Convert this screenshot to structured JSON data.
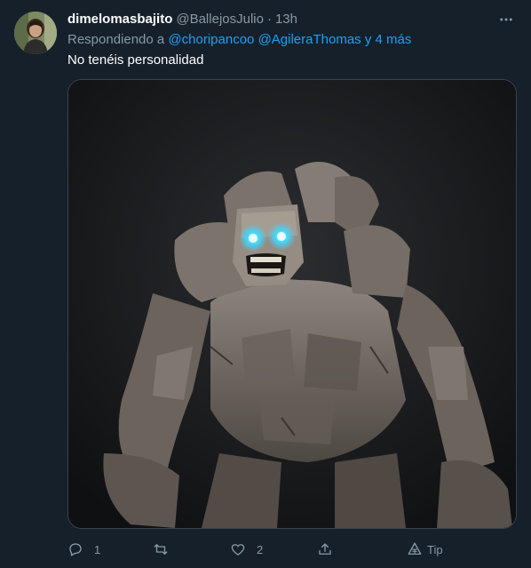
{
  "tweet": {
    "display_name": "dimelomasbajito",
    "handle": "@BallejosJulio",
    "separator": "·",
    "time": "13h",
    "reply_prefix": "Respondiendo a",
    "mention_1": "@choripancoo",
    "mention_2": "@AgileraThomas",
    "reply_others": "y 4 más",
    "text": "No tenéis personalidad",
    "media_subject": "stone golem"
  },
  "actions": {
    "reply_count": "1",
    "retweet_count": "",
    "like_count": "2",
    "tip_label": "Tip"
  },
  "colors": {
    "background": "#15202b",
    "text_primary": "#ffffff",
    "text_secondary": "#8899a6",
    "link": "#1da1f2",
    "border": "#38444d",
    "golem_eyes": "#3fd8ff"
  },
  "icons": {
    "more": "more-horizontal-icon",
    "reply": "reply-icon",
    "retweet": "retweet-icon",
    "like": "heart-icon",
    "share": "share-icon",
    "tip": "tip-icon"
  }
}
